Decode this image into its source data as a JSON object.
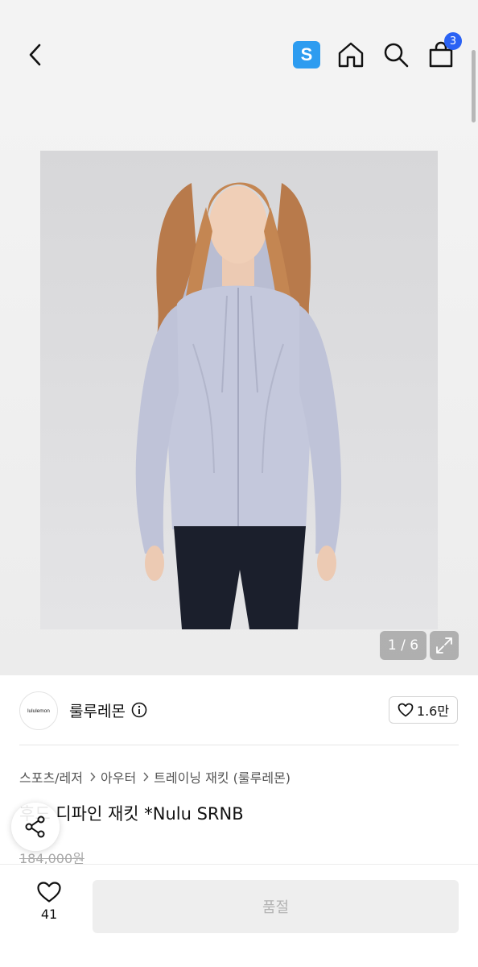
{
  "header": {
    "badge_label": "S",
    "cart_count": "3",
    "icons": [
      "back-icon",
      "s-service-icon",
      "home-icon",
      "search-icon",
      "cart-icon"
    ]
  },
  "gallery": {
    "counter": "1 / 6",
    "expand_icon": "expand-icon"
  },
  "shop": {
    "logo_text": "lululemon",
    "name": "룰루레몬",
    "like_count": "1.6만"
  },
  "breadcrumb": [
    "스포츠/레저",
    "아우터",
    "트레이닝 재킷 (룰루레몬)"
  ],
  "product": {
    "title": "후드 디파인 재킷 *Nulu SRNB",
    "original_price": "184,000원"
  },
  "bottom_bar": {
    "fav_count": "41",
    "soldout_label": "품절"
  },
  "colors": {
    "badge": "#2d9cf0",
    "cart_badge": "#2a62f4",
    "jacket": "#c4c8dc"
  }
}
